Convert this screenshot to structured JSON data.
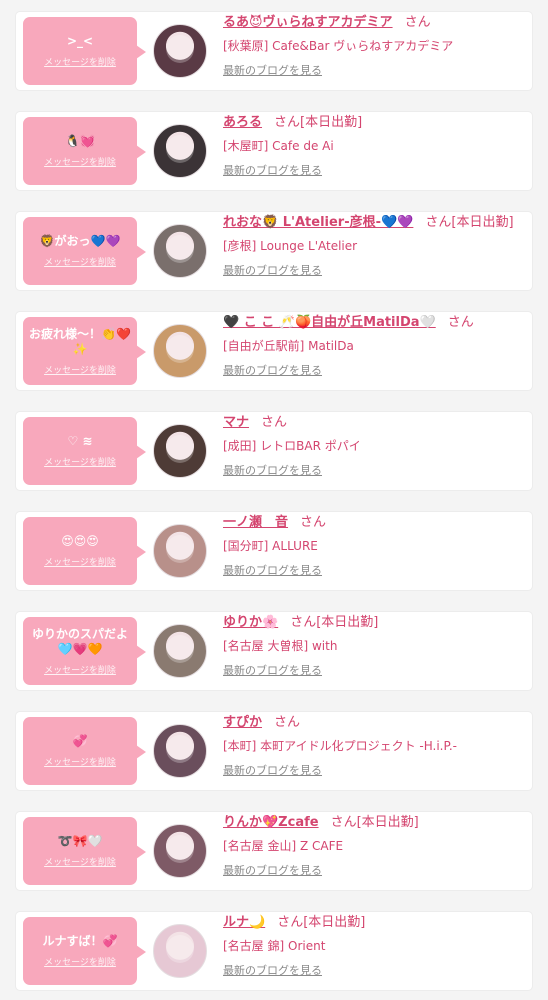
{
  "colors": {
    "accent": "#d4456f",
    "bubble": "#f8a8bc",
    "background": "#f4f4f4",
    "card": "#ffffff"
  },
  "delete_label": "メッセージを削除",
  "blog_label": "最新のブログを見る",
  "honorific": "さん",
  "cards": [
    {
      "message": ">_<",
      "name": "るあ😈ヴぃらねすアカデミア",
      "working": "",
      "shop": "[秋葉原] Cafe&Bar ヴぃらねすアカデミア",
      "avatar_color": "#5a3a45"
    },
    {
      "message": "🐧💓",
      "name": "あろる",
      "working": "[本日出勤]",
      "shop": "[木屋町] Cafe de Ai",
      "avatar_color": "#3b3336"
    },
    {
      "message": "🦁がおっ💙💜",
      "name": "れおな🦁 L'Atelier-彦根-💙💜",
      "working": "[本日出勤]",
      "shop": "[彦根] Lounge L'Atelier",
      "avatar_color": "#7a6f6c"
    },
    {
      "message": "お疲れ様〜！👏❤️✨",
      "name": "🖤 こ こ 🥂🍑自由が丘MatilDa🤍",
      "working": "",
      "shop": "[自由が丘駅前] MatilDa",
      "avatar_color": "#c99a6a"
    },
    {
      "message": "♡ ≋",
      "name": "マナ",
      "working": "",
      "shop": "[成田] レトロBAR ポパイ",
      "avatar_color": "#4e3b36"
    },
    {
      "message": "😍😍😍",
      "name": "一ノ瀬　音",
      "working": "",
      "shop": "[国分町] ALLURE",
      "avatar_color": "#b8908a"
    },
    {
      "message": "ゆりかのスパだよ🩵💗🧡",
      "name": "ゆりか🌸",
      "working": "[本日出勤]",
      "shop": "[名古屋 大曽根] with",
      "avatar_color": "#8a7a70"
    },
    {
      "message": "💞",
      "name": "すぴか",
      "working": "",
      "shop": "[本町] 本町アイドル化プロジェクト -H.i.P.-",
      "avatar_color": "#6a4e5c"
    },
    {
      "message": "➰🎀🤍",
      "name": "りんか💖Zcafe",
      "working": "[本日出勤]",
      "shop": "[名古屋 金山] Z CAFE",
      "avatar_color": "#7e5a66"
    },
    {
      "message": "ルナすば！💞",
      "name": "ルナ🌙",
      "working": "[本日出勤]",
      "shop": "[名古屋 錦] Orient",
      "avatar_color": "#e6c8d4"
    }
  ]
}
